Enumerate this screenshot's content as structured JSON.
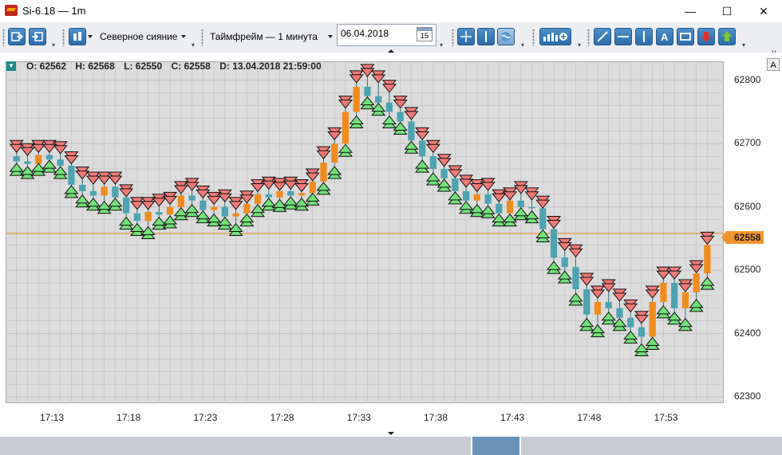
{
  "window": {
    "title": "Si-6.18 — 1m",
    "minimize": "—",
    "maximize": "☐",
    "close": "✕"
  },
  "toolbar": {
    "style_combo": "Северное сияние",
    "timeframe_combo": "Таймфрейм — 1 минута",
    "date_value": "06.04.2018",
    "calendar_day": "15",
    "side_label": "v"
  },
  "chart_header": {
    "open": "O: 62562",
    "high": "H: 62568",
    "low": "L: 62550",
    "close": "C: 62558",
    "date": "D: 13.04.2018 21:59:00",
    "autoscale": "A"
  },
  "chart_data": {
    "type": "candlestick",
    "y_ticks": [
      "62800",
      "62700",
      "62600",
      "62500",
      "62400",
      "62300"
    ],
    "x_ticks": [
      "17:13",
      "17:18",
      "17:23",
      "17:28",
      "17:33",
      "17:38",
      "17:43",
      "17:48",
      "17:53"
    ],
    "ylim": [
      62290,
      62830
    ],
    "current_price": "62558",
    "colors": {
      "up": "#f08c1e",
      "down": "#4da3b0",
      "grid": "#c0c0c0",
      "bg": "#dcdcdc",
      "arrow_up": "#73e07a",
      "arrow_down": "#f07a78",
      "price_line": "#f08c1e"
    },
    "candles": [
      [
        62680,
        62690,
        62665,
        62672
      ],
      [
        62672,
        62685,
        62660,
        62668
      ],
      [
        62668,
        62690,
        62665,
        62682
      ],
      [
        62682,
        62690,
        62670,
        62675
      ],
      [
        62675,
        62688,
        62660,
        62665
      ],
      [
        62665,
        62672,
        62630,
        62635
      ],
      [
        62635,
        62648,
        62615,
        62625
      ],
      [
        62625,
        62640,
        62610,
        62618
      ],
      [
        62618,
        62640,
        62605,
        62632
      ],
      [
        62632,
        62640,
        62610,
        62615
      ],
      [
        62615,
        62620,
        62580,
        62590
      ],
      [
        62590,
        62600,
        62570,
        62578
      ],
      [
        62578,
        62600,
        62565,
        62592
      ],
      [
        62592,
        62605,
        62580,
        62588
      ],
      [
        62588,
        62608,
        62582,
        62600
      ],
      [
        62600,
        62625,
        62595,
        62618
      ],
      [
        62618,
        62630,
        62600,
        62610
      ],
      [
        62610,
        62618,
        62590,
        62595
      ],
      [
        62595,
        62608,
        62585,
        62600
      ],
      [
        62600,
        62612,
        62580,
        62585
      ],
      [
        62585,
        62600,
        62570,
        62590
      ],
      [
        62590,
        62610,
        62585,
        62605
      ],
      [
        62605,
        62628,
        62600,
        62620
      ],
      [
        62620,
        62632,
        62610,
        62615
      ],
      [
        62615,
        62630,
        62608,
        62625
      ],
      [
        62625,
        62632,
        62612,
        62618
      ],
      [
        62618,
        62628,
        62610,
        62622
      ],
      [
        62622,
        62645,
        62618,
        62640
      ],
      [
        62640,
        62680,
        62635,
        62670
      ],
      [
        62670,
        62710,
        62660,
        62700
      ],
      [
        62700,
        62760,
        62695,
        62750
      ],
      [
        62750,
        62800,
        62740,
        62790
      ],
      [
        62790,
        62810,
        62770,
        62775
      ],
      [
        62775,
        62800,
        62760,
        62765
      ],
      [
        62765,
        62785,
        62740,
        62750
      ],
      [
        62750,
        62760,
        62730,
        62735
      ],
      [
        62735,
        62742,
        62700,
        62705
      ],
      [
        62705,
        62710,
        62670,
        62680
      ],
      [
        62680,
        62690,
        62650,
        62660
      ],
      [
        62660,
        62668,
        62640,
        62645
      ],
      [
        62645,
        62650,
        62620,
        62625
      ],
      [
        62625,
        62635,
        62605,
        62610
      ],
      [
        62610,
        62628,
        62600,
        62620
      ],
      [
        62620,
        62630,
        62598,
        62605
      ],
      [
        62605,
        62612,
        62585,
        62590
      ],
      [
        62590,
        62615,
        62585,
        62610
      ],
      [
        62610,
        62625,
        62595,
        62600
      ],
      [
        62600,
        62615,
        62590,
        62598
      ],
      [
        62598,
        62602,
        62560,
        62565
      ],
      [
        62565,
        62570,
        62510,
        62520
      ],
      [
        62520,
        62535,
        62495,
        62505
      ],
      [
        62505,
        62525,
        62460,
        62470
      ],
      [
        62470,
        62480,
        62420,
        62430
      ],
      [
        62430,
        62460,
        62410,
        62450
      ],
      [
        62450,
        62470,
        62430,
        62440
      ],
      [
        62440,
        62455,
        62420,
        62425
      ],
      [
        62425,
        62438,
        62400,
        62410
      ],
      [
        62410,
        62420,
        62380,
        62395
      ],
      [
        62395,
        62460,
        62390,
        62450
      ],
      [
        62450,
        62490,
        62440,
        62480
      ],
      [
        62480,
        62490,
        62430,
        62440
      ],
      [
        62440,
        62470,
        62420,
        62465
      ],
      [
        62465,
        62500,
        62450,
        62495
      ],
      [
        62495,
        62545,
        62485,
        62540
      ]
    ]
  }
}
